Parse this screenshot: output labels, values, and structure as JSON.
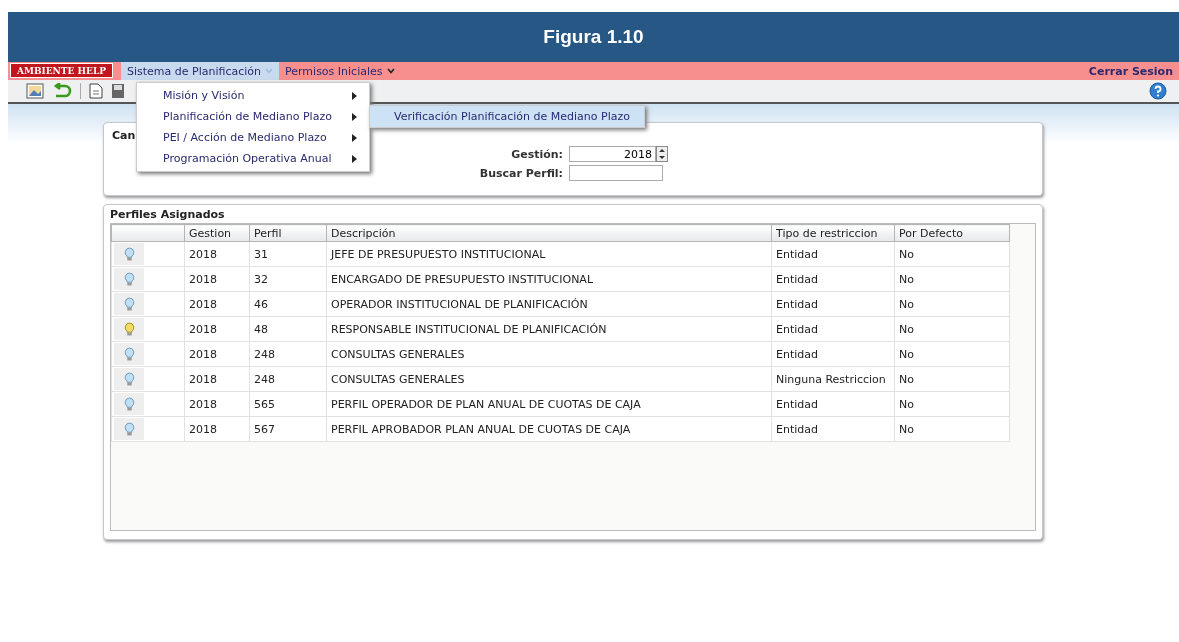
{
  "banner": {
    "title": "Figura 1.10"
  },
  "menu_bar": {
    "badge": "AMBIENTE HELP",
    "items": [
      {
        "label": "Sistema de Planificación",
        "selected": true
      },
      {
        "label": "Permisos Iniciales",
        "selected": false
      }
    ],
    "logout": "Cerrar Sesion"
  },
  "dropdown": {
    "items": [
      {
        "label": "Misión y Visión"
      },
      {
        "label": "Planificación de Mediano Plazo"
      },
      {
        "label": "PEI / Acción de Mediano Plazo"
      },
      {
        "label": "Programación Operativa Anual"
      }
    ],
    "submenu": {
      "items": [
        {
          "label": "Verificación Planificación de Mediano Plazo",
          "selected": true
        }
      ]
    }
  },
  "filter_card": {
    "title": "Can",
    "gestion_label": "Gestión:",
    "gestion_value": "2018",
    "search_label": "Buscar Perfil:"
  },
  "profiles": {
    "title": "Perfiles Asignados",
    "columns": [
      "Gestion",
      "Perfil",
      "Descripción",
      "Tipo de restriccion",
      "Por Defecto"
    ],
    "rows": [
      {
        "active": false,
        "cells": [
          "2018",
          "31",
          "JEFE DE PRESUPUESTO INSTITUCIONAL",
          "Entidad",
          "No"
        ]
      },
      {
        "active": false,
        "cells": [
          "2018",
          "32",
          "ENCARGADO DE PRESUPUESTO INSTITUCIONAL",
          "Entidad",
          "No"
        ]
      },
      {
        "active": false,
        "cells": [
          "2018",
          "46",
          "OPERADOR INSTITUCIONAL DE PLANIFICACIÓN",
          "Entidad",
          "No"
        ]
      },
      {
        "active": true,
        "cells": [
          "2018",
          "48",
          "RESPONSABLE INSTITUCIONAL DE PLANIFICACIÓN",
          "Entidad",
          "No"
        ]
      },
      {
        "active": false,
        "cells": [
          "2018",
          "248",
          "CONSULTAS GENERALES",
          "Entidad",
          "No"
        ]
      },
      {
        "active": false,
        "cells": [
          "2018",
          "248",
          "CONSULTAS GENERALES",
          "Ninguna Restriccion",
          "No"
        ]
      },
      {
        "active": false,
        "cells": [
          "2018",
          "565",
          "PERFIL OPERADOR DE PLAN ANUAL DE CUOTAS DE CAJA",
          "Entidad",
          "No"
        ]
      },
      {
        "active": false,
        "cells": [
          "2018",
          "567",
          "PERFIL APROBADOR PLAN ANUAL DE CUOTAS DE CAJA",
          "Entidad",
          "No"
        ]
      }
    ]
  }
}
